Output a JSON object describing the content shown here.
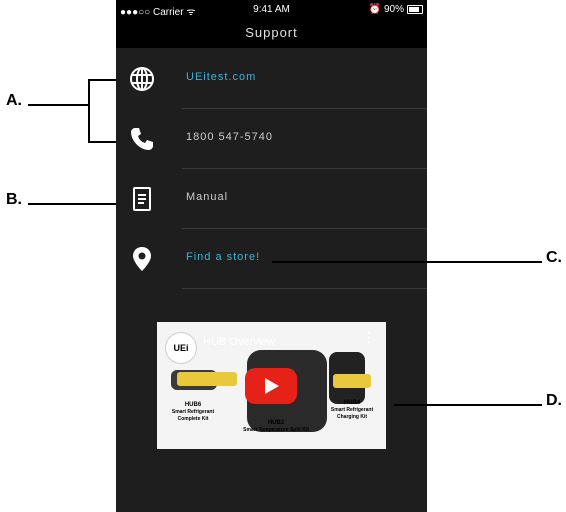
{
  "status_bar": {
    "carrier": "●●●○○ Carrier ᯤ",
    "time": "9:41 AM",
    "battery": "⏰ 90%"
  },
  "nav": {
    "title": "Support"
  },
  "support_items": [
    {
      "label": "UEitest.com",
      "icon": "globe-icon"
    },
    {
      "label": "1800 547-5740",
      "icon": "phone-icon"
    },
    {
      "label": "Manual",
      "icon": "document-icon"
    },
    {
      "label": "Find a store!",
      "icon": "location-pin-icon"
    }
  ],
  "video": {
    "title": "HUB Overview",
    "logo": "UEi",
    "product_hub6": "HUB6",
    "product_hub6_desc": "Smart Refrigerant Complete Kit",
    "product_hub2": "HUB2",
    "product_hub2_desc": "Smart Temperature Split Kit",
    "product_hub4": "HUB4",
    "product_hub4_desc": "Smart Refrigerant Charging Kit"
  },
  "annotations": {
    "a": "A.",
    "b": "B.",
    "c": "C.",
    "d": "D."
  },
  "colors": {
    "link": "#3fb3d8",
    "background": "#1e1e1e",
    "youtube_red": "#e62117"
  }
}
